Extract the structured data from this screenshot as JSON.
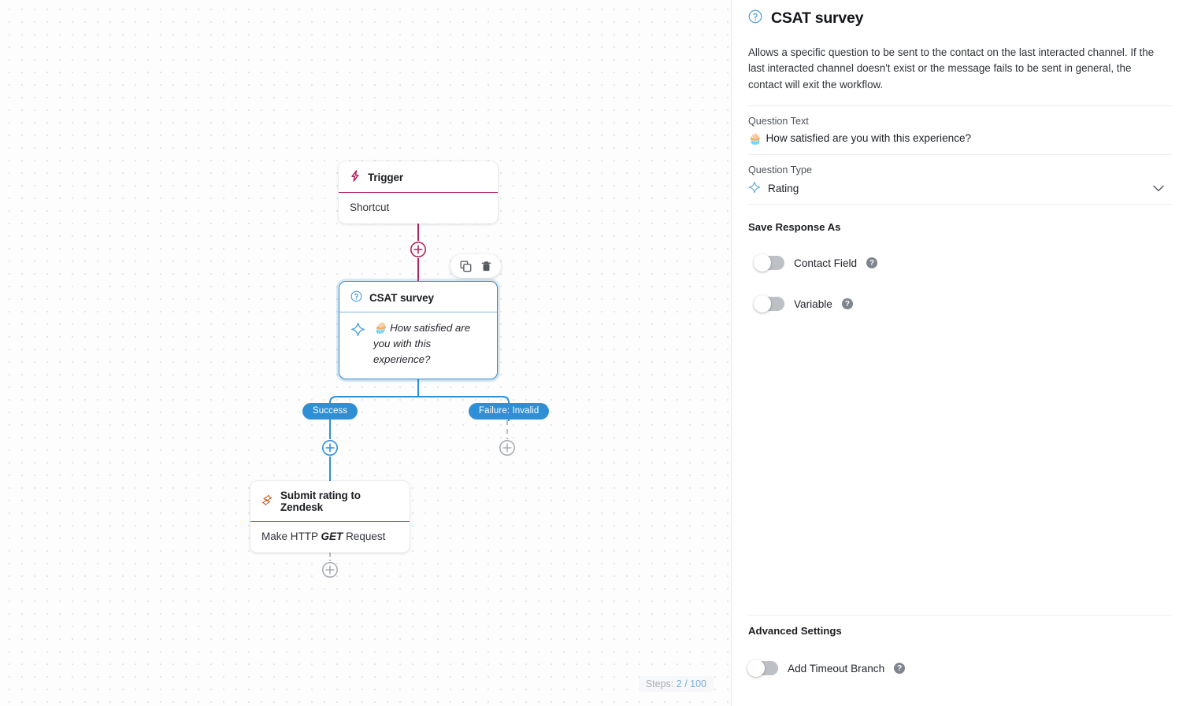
{
  "canvas": {
    "nodes": {
      "trigger": {
        "title": "Trigger",
        "icon": "lightning-bolt-icon",
        "body": "Shortcut"
      },
      "csat": {
        "title": "CSAT survey",
        "icon": "question-circle-icon",
        "message_emoji": "🧁",
        "message": "How satisfied are you with this experience?"
      },
      "zendesk": {
        "title": "Submit rating to Zendesk",
        "icon": "zendesk-bolt-icon",
        "body_prefix": "Make HTTP",
        "body_verb": "GET",
        "body_suffix": "Request"
      }
    },
    "branches": {
      "success": "Success",
      "failure": "Failure: Invalid"
    },
    "toolbar": {
      "copy": "copy-icon",
      "delete": "trash-icon"
    },
    "steps": {
      "label": "Steps:",
      "count": "2 / 100"
    }
  },
  "panel": {
    "title": "CSAT survey",
    "title_icon": "question-circle-icon",
    "description": "Allows a specific question to be sent to the contact on the last interacted channel. If the last interacted channel doesn't exist or the message fails to be sent in general, the contact will exit the workflow.",
    "question_text": {
      "label": "Question Text",
      "emoji": "🧁",
      "value": "How satisfied are you with this experience?"
    },
    "question_type": {
      "label": "Question Type",
      "value": "Rating",
      "icon": "sparkle-icon",
      "chevron": "chevron-down-icon"
    },
    "save_response": {
      "title": "Save Response As",
      "toggles": [
        {
          "label": "Contact Field",
          "state": "off",
          "help": "help-icon"
        },
        {
          "label": "Variable",
          "state": "off",
          "help": "help-icon"
        }
      ]
    },
    "advanced": {
      "title": "Advanced Settings",
      "toggles": [
        {
          "label": "Add Timeout Branch",
          "state": "off",
          "help": "help-icon"
        }
      ]
    }
  },
  "colors": {
    "trigger_accent": "#b1245f",
    "csat_accent": "#2e8fd4",
    "zendesk_accent": "#c4541c",
    "branch_pill": "#2f8fd6"
  }
}
